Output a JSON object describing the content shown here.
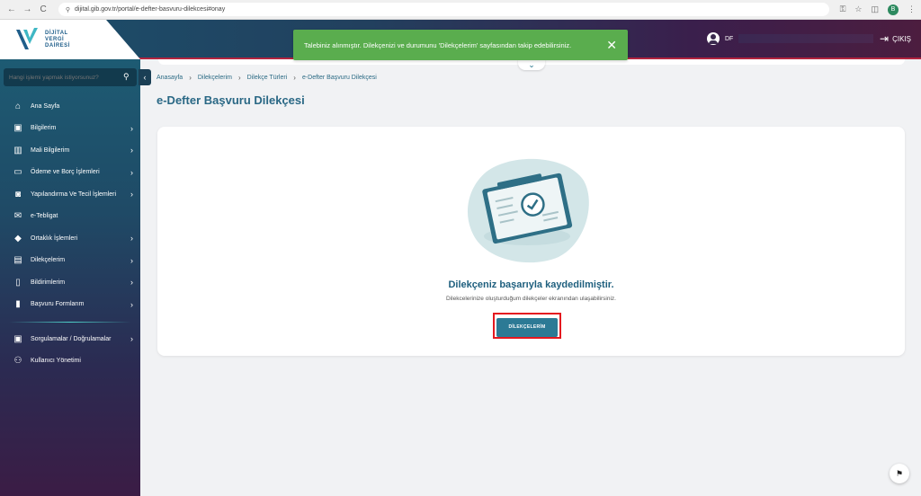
{
  "browser": {
    "url": "dijital.gib.gov.tr/portal/e-defter-basvuru-dilekcesi#onay",
    "nav": {
      "back": "←",
      "forward": "→",
      "reload": "C"
    },
    "profile_initial": "B"
  },
  "header": {
    "logo_lines": [
      "DİJİTAL",
      "VERGİ",
      "DAİRESİ"
    ],
    "user_name": "DF",
    "logout_label": "ÇIKIŞ"
  },
  "toast": {
    "message": "Talebiniz alınmıştır. Dilekçenizi ve durumunu 'Dilekçelerim' sayfasından takip edebilirsiniz.",
    "close_glyph": "✕",
    "color": "#5aad4e"
  },
  "sidebar": {
    "search_placeholder": "Hangi işlemi yapmak istiyorsunuz?",
    "collapse_glyph": "‹",
    "items": [
      {
        "label": "Ana Sayfa",
        "icon": "home-icon",
        "has_arrow": false
      },
      {
        "label": "Bilgilerim",
        "icon": "id-card-icon",
        "has_arrow": true
      },
      {
        "label": "Mali Bilgilerim",
        "icon": "chart-icon",
        "has_arrow": true
      },
      {
        "label": "Ödeme ve Borç İşlemleri",
        "icon": "credit-card-icon",
        "has_arrow": true
      },
      {
        "label": "Yapılandırma Ve Tecil İşlemleri",
        "icon": "cash-icon",
        "has_arrow": true
      },
      {
        "label": "e-Tebligat",
        "icon": "mail-icon",
        "has_arrow": false
      },
      {
        "label": "Ortaklık İşlemleri",
        "icon": "handshake-icon",
        "has_arrow": true
      },
      {
        "label": "Dilekçelerim",
        "icon": "book-icon",
        "has_arrow": true
      },
      {
        "label": "Bildirimlerim",
        "icon": "bookmark-icon",
        "has_arrow": true
      },
      {
        "label": "Başvuru Formlarım",
        "icon": "document-icon",
        "has_arrow": true
      }
    ],
    "secondary_items": [
      {
        "label": "Sorgulamalar / Doğrulamalar",
        "icon": "search-doc-icon",
        "has_arrow": true
      },
      {
        "label": "Kullanıcı Yönetimi",
        "icon": "users-icon",
        "has_arrow": false
      }
    ]
  },
  "breadcrumb": [
    "Anasayfa",
    "Dilekçelerim",
    "Dilekçe Türleri",
    "e-Defter Başvuru Dilekçesi"
  ],
  "page": {
    "title": "e-Defter Başvuru Dilekçesi",
    "success_title": "Dilekçeniz başarıyla kaydedilmiştir.",
    "success_subtitle": "Dilekcelerinize oluşturduğum dilekçeler ekranından ulaşabilirsiniz.",
    "button_label": "DİLEKÇELERİM"
  },
  "colors": {
    "accent": "#2c7a95",
    "title": "#2a6885",
    "highlight_border": "#e4181f"
  }
}
